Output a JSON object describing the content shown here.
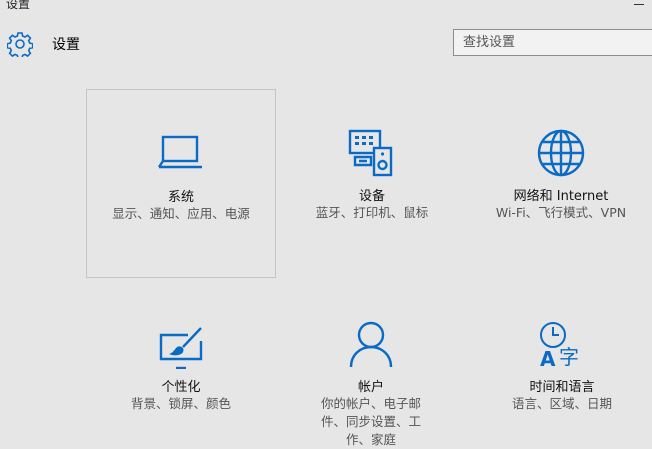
{
  "window": {
    "title": "设置"
  },
  "header": {
    "title": "设置",
    "icon": "gear-icon"
  },
  "search": {
    "placeholder": "查找设置"
  },
  "accent_color": "#0b6bc4",
  "tiles": [
    {
      "label": "系统",
      "desc": "显示、通知、应用、电源",
      "icon": "laptop-icon",
      "selected": true
    },
    {
      "label": "设备",
      "desc": "蓝牙、打印机、鼠标",
      "icon": "devices-icon"
    },
    {
      "label": "网络和 Internet",
      "desc": "Wi-Fi、飞行模式、VPN",
      "icon": "globe-icon"
    },
    {
      "label": "个性化",
      "desc": "背景、锁屏、颜色",
      "icon": "personalization-icon"
    },
    {
      "label": "帐户",
      "desc": "你的帐户、电子邮件、同步设置、工作、家庭",
      "icon": "person-icon"
    },
    {
      "label": "时间和语言",
      "desc": "语言、区域、日期",
      "icon": "time-language-icon"
    }
  ]
}
